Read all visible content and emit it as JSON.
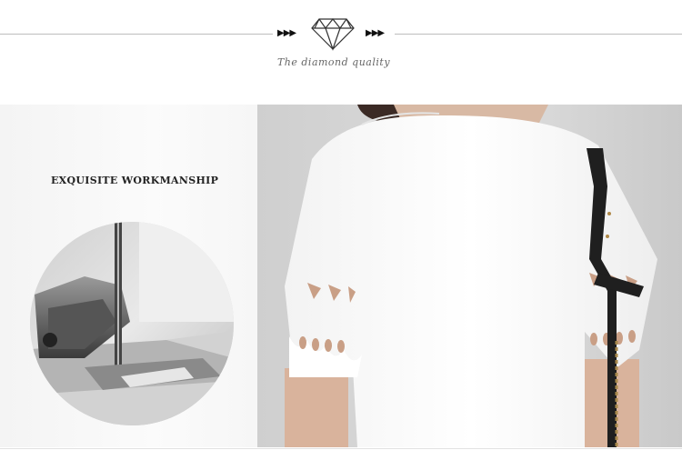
{
  "header": {
    "tagline": "The diamond quality",
    "icon": "diamond-icon",
    "arrow_glyph": "▶▶▶"
  },
  "feature": {
    "title": "EXQUISITE WORKMANSHIP",
    "image_icon": "sewing-machine-icon"
  },
  "colors": {
    "rule": "#bdbdbd",
    "text": "#222222",
    "shirt": "#ffffff",
    "wall": "#d6d6d6"
  }
}
